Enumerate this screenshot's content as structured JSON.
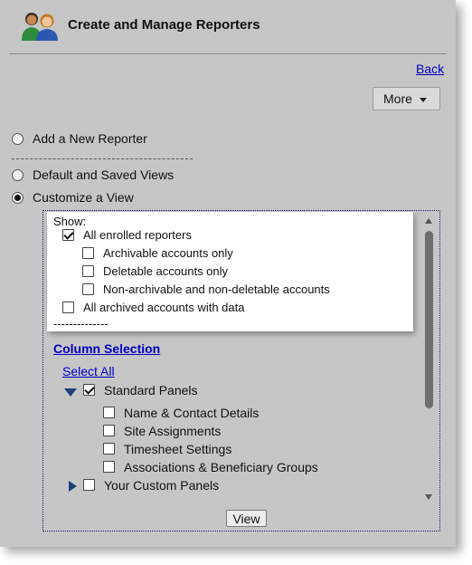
{
  "header": {
    "title": "Create and Manage Reporters",
    "icon": "users-icon"
  },
  "nav": {
    "back_label": "Back",
    "more_label": "More"
  },
  "radios": [
    {
      "label": "Add a New Reporter",
      "checked": false
    },
    {
      "label": "Default and Saved Views",
      "checked": false
    },
    {
      "label": "Customize a View",
      "checked": true
    }
  ],
  "show": {
    "label": "Show:",
    "separator": "--------------",
    "options": [
      {
        "label": "All enrolled reporters",
        "checked": true
      },
      {
        "label": "Archivable accounts only",
        "checked": false
      },
      {
        "label": "Deletable accounts only",
        "checked": false
      },
      {
        "label": "Non-archivable and non-deletable accounts",
        "checked": false
      },
      {
        "label": "All archived accounts with data",
        "checked": false
      }
    ]
  },
  "columns": {
    "title": "Column Selection",
    "select_all": "Select All",
    "standard": {
      "label": "Standard Panels",
      "checked": true,
      "expanded": true
    },
    "standard_items": [
      {
        "label": "Name & Contact Details",
        "checked": false
      },
      {
        "label": "Site Assignments",
        "checked": false
      },
      {
        "label": "Timesheet Settings",
        "checked": false
      },
      {
        "label": "Associations & Beneficiary Groups",
        "checked": false
      }
    ],
    "custom": {
      "label": "Your Custom Panels",
      "checked": false,
      "expanded": false
    }
  },
  "view_button": "View",
  "colors": {
    "background": "#c6c6c6",
    "link": "#0000c8",
    "tree_arrow": "#1d3f7a"
  }
}
